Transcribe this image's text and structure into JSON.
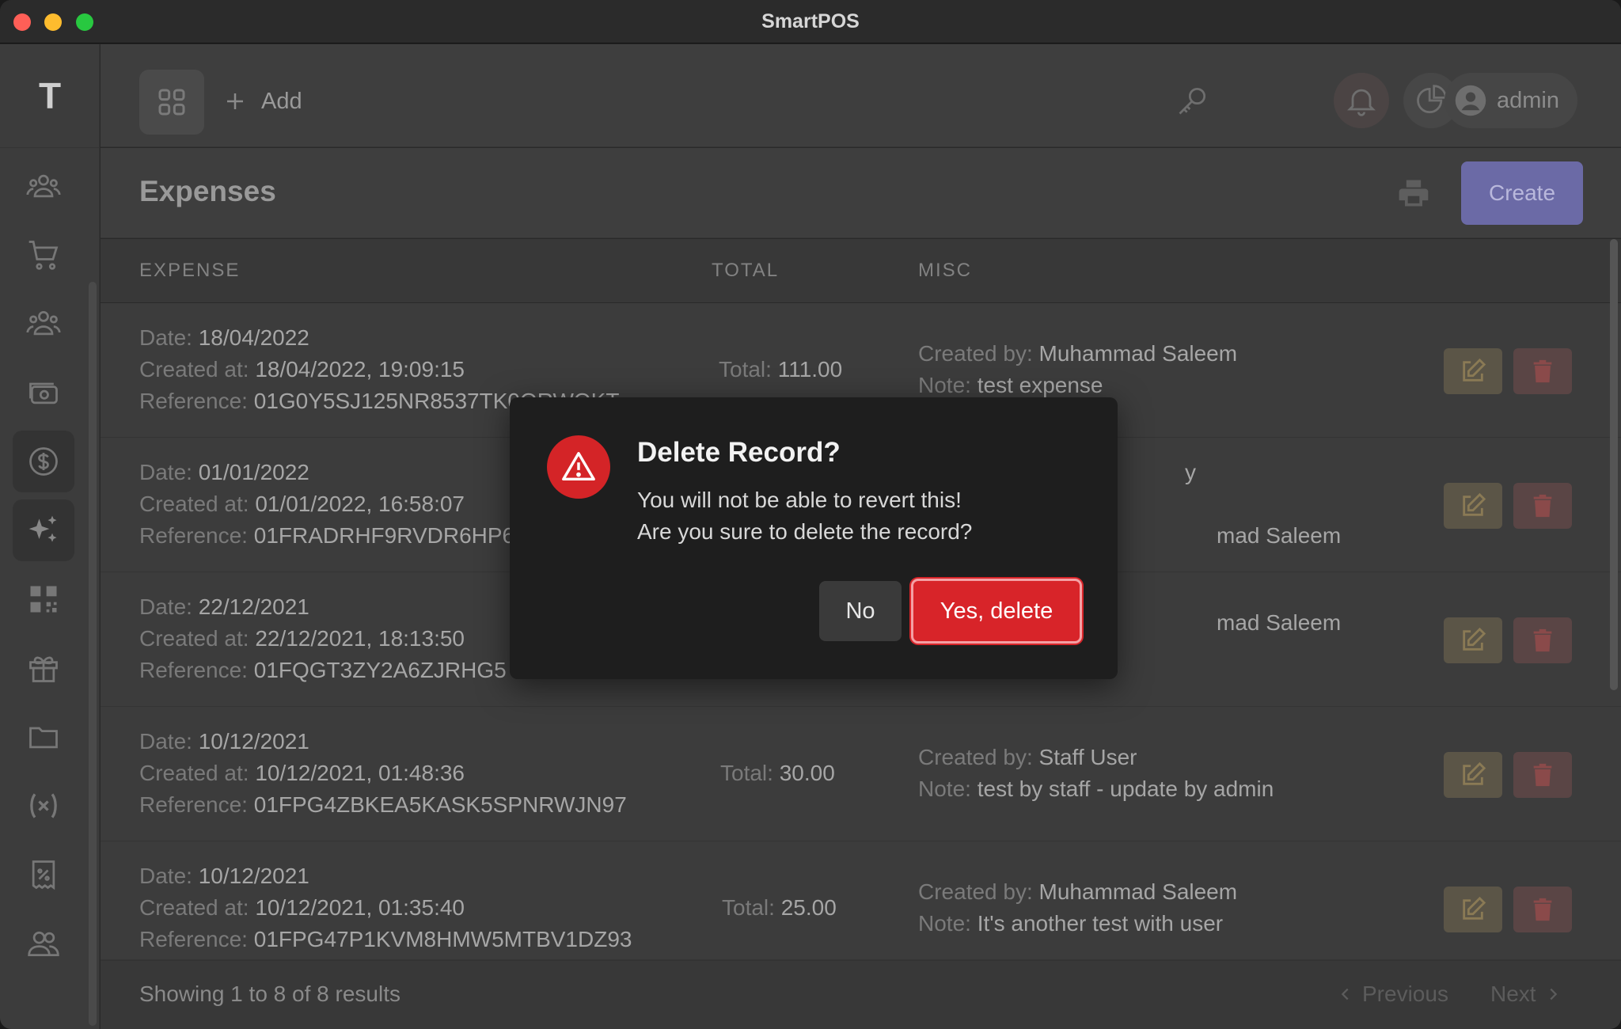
{
  "window": {
    "title": "SmartPOS"
  },
  "sidebar": {
    "logo": "T",
    "items": [
      {
        "icon": "customers-icon"
      },
      {
        "icon": "cart-icon"
      },
      {
        "icon": "suppliers-icon"
      },
      {
        "icon": "cash-icon"
      },
      {
        "icon": "dollar-icon",
        "active": true
      },
      {
        "icon": "sparkles-icon",
        "active": true
      },
      {
        "icon": "qrcode-icon"
      },
      {
        "icon": "gift-icon"
      },
      {
        "icon": "folder-icon"
      },
      {
        "icon": "variable-icon"
      },
      {
        "icon": "receipt-percent-icon"
      },
      {
        "icon": "users-icon"
      }
    ]
  },
  "topbar": {
    "add_label": "Add",
    "user_label": "admin"
  },
  "page": {
    "title": "Expenses",
    "create_label": "Create"
  },
  "table": {
    "headers": {
      "expense": "EXPENSE",
      "total": "TOTAL",
      "misc": "MISC"
    },
    "labels": {
      "date": "Date:",
      "created_at": "Created at:",
      "reference": "Reference:",
      "total": "Total:",
      "created_by": "Created by:",
      "note": "Note:"
    },
    "rows": [
      {
        "date": "18/04/2022",
        "created_at": "18/04/2022, 19:09:15",
        "reference": "01G0Y5SJ125NR8537TK0QRWQKT",
        "total": "111.00",
        "created_by": "Muhammad Saleem",
        "note": "test expense"
      },
      {
        "date": "01/01/2022",
        "created_at": "01/01/2022, 16:58:07",
        "reference": "01FRADRHF9RVDR6HP6",
        "misc_partial_1": "y",
        "misc_partial_2": "mad Saleem"
      },
      {
        "date": "22/12/2021",
        "created_at": "22/12/2021, 18:13:50",
        "reference": "01FQGT3ZY2A6ZJRHG5",
        "misc_partial_1": "mad Saleem"
      },
      {
        "date": "10/12/2021",
        "created_at": "10/12/2021, 01:48:36",
        "reference": "01FPG4ZBKEA5KASK5SPNRWJN97",
        "total": "30.00",
        "created_by": "Staff User",
        "note": "test by staff - update by admin"
      },
      {
        "date": "10/12/2021",
        "created_at": "10/12/2021, 01:35:40",
        "reference": "01FPG47P1KVM8HMW5MTBV1DZ93",
        "total": "25.00",
        "created_by": "Muhammad Saleem",
        "note": "It's another test with user"
      }
    ]
  },
  "footer": {
    "showing": "Showing 1 to 8 of 8 results",
    "previous": "Previous",
    "next": "Next"
  },
  "dialog": {
    "title": "Delete Record?",
    "line1": "You will not be able to revert this!",
    "line2": "Are you sure to delete the record?",
    "no_label": "No",
    "yes_label": "Yes, delete"
  },
  "colors": {
    "danger": "#d82429",
    "create": "#6b6aa6",
    "dialog_bg": "#1e1e1e"
  }
}
